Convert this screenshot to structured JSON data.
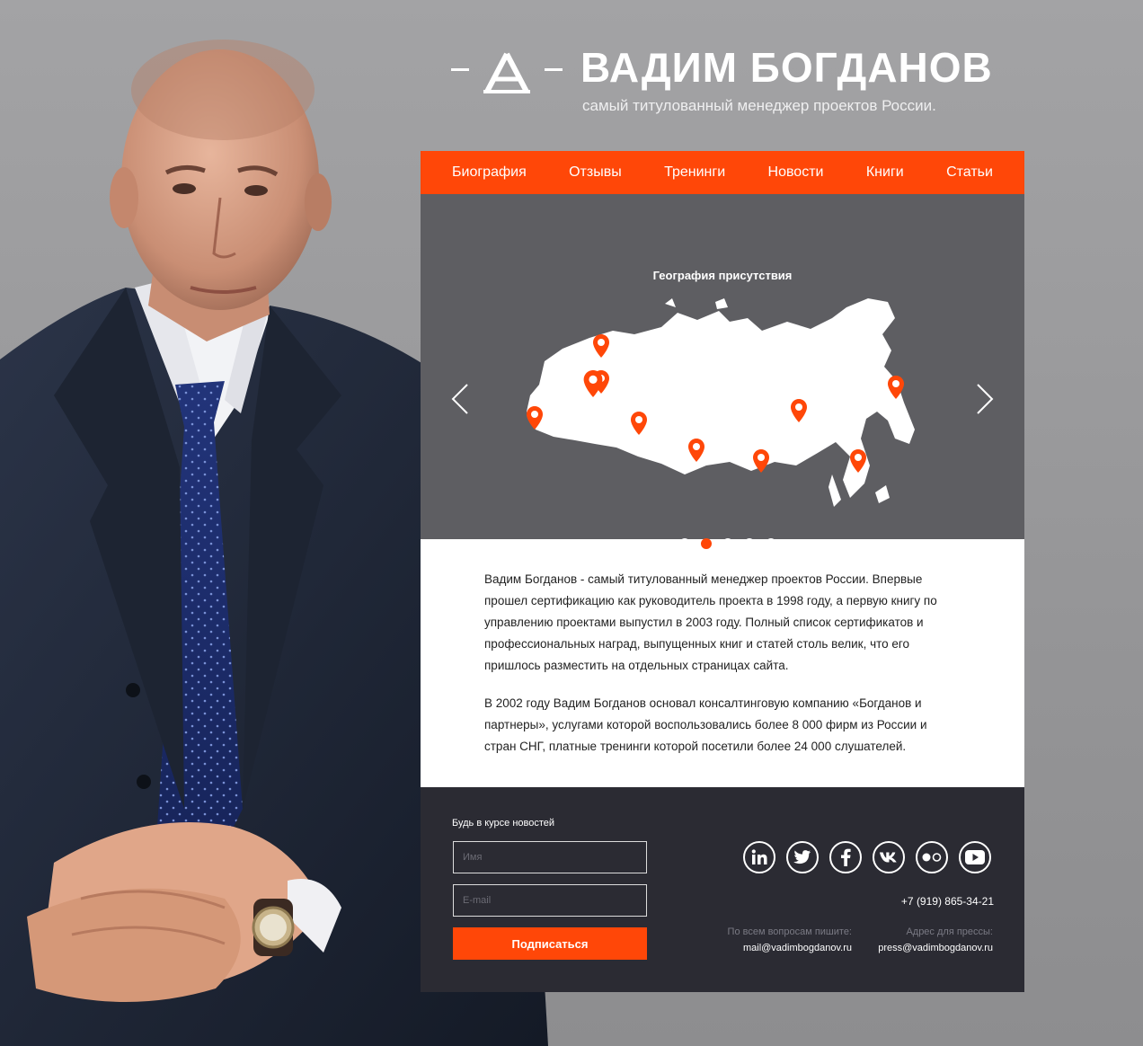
{
  "header": {
    "title": "ВАДИМ БОГДАНОВ",
    "subtitle": "самый титулованный менеджер проектов России."
  },
  "nav": [
    {
      "label": "Биография"
    },
    {
      "label": "Отзывы"
    },
    {
      "label": "Тренинги"
    },
    {
      "label": "Новости"
    },
    {
      "label": "Книги"
    },
    {
      "label": "Статьи"
    }
  ],
  "slider": {
    "title": "География присутствия",
    "slide_count": 5,
    "active_slide": 2
  },
  "about": {
    "paragraphs": [
      "Вадим Богданов - самый титулованный менеджер проектов России. Впервые прошел сертификацию как руководитель проекта в 1998 году, а первую книгу по управлению проектами выпустил в 2003 году. Полный список сертификатов и профессиональных наград, выпущенных книг и статей столь велик, что его пришлось разместить на отдельных страницах сайта.",
      "В 2002 году Вадим Богданов основал консалтинговую компанию «Богданов и партнеры», услугами которой воспользовались более 8 000 фирм из России и стран СНГ, платные тренинги которой посетили более 24 000 слушателей."
    ]
  },
  "footer": {
    "subscribe_label": "Будь в курсе новостей",
    "name_placeholder": "Имя",
    "email_placeholder": "E-mail",
    "subscribe_button": "Подписаться",
    "social": [
      "linkedin-icon",
      "twitter-icon",
      "facebook-icon",
      "vk-icon",
      "flickr-icon",
      "youtube-icon"
    ],
    "phone": "+7 (919) 865-34-21",
    "general_label": "По всем вопросам пишите:",
    "general_email": "mail@vadimbogdanov.ru",
    "press_label": "Адрес для прессы:",
    "press_email": "press@vadimbogdanov.ru"
  },
  "colors": {
    "accent": "#ff4708",
    "slider_bg": "#5e5e62",
    "footer_bg": "#2b2b33",
    "page_bg": "#979799"
  }
}
